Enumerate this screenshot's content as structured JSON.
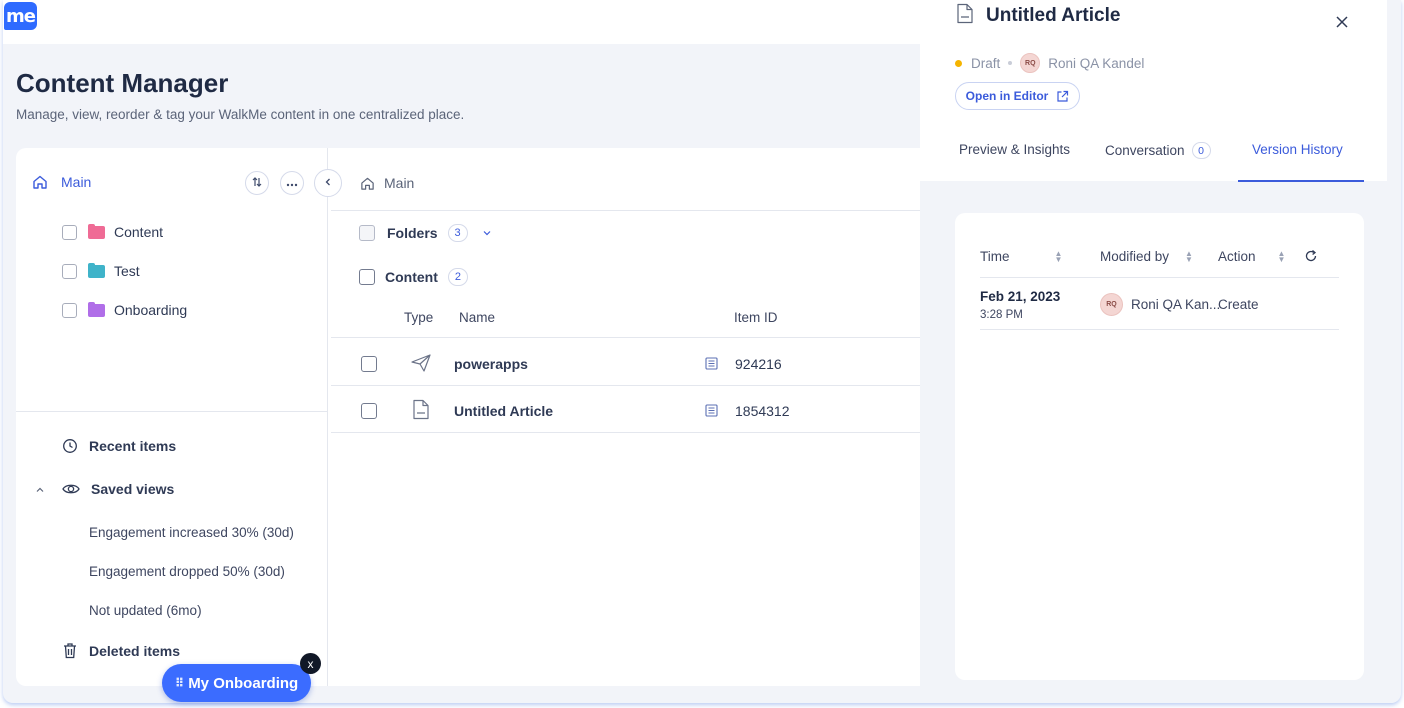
{
  "app": {
    "logo_text": "me",
    "brand_color": "#2f6bff"
  },
  "page": {
    "title": "Content Manager",
    "subtitle": "Manage, view, reorder & tag your WalkMe content in one centralized place."
  },
  "sidebar": {
    "root_label": "Main",
    "folders": [
      {
        "label": "Content",
        "color": "#ef6b95"
      },
      {
        "label": "Test",
        "color": "#3fb3c9"
      },
      {
        "label": "Onboarding",
        "color": "#b06ee8"
      }
    ],
    "recent_label": "Recent items",
    "saved_views_label": "Saved views",
    "saved_views": [
      "Engagement increased 30% (30d)",
      "Engagement dropped 50% (30d)",
      "Not updated (6mo)"
    ],
    "deleted_label": "Deleted items"
  },
  "main": {
    "breadcrumb": "Main",
    "folders_label": "Folders",
    "folders_count": "3",
    "content_label": "Content",
    "content_count": "2",
    "columns": {
      "type": "Type",
      "name": "Name",
      "item_id": "Item ID"
    },
    "rows": [
      {
        "type_icon": "paper-plane-icon",
        "name": "powerapps",
        "item_id": "924216"
      },
      {
        "type_icon": "article-icon",
        "name": "Untitled Article",
        "item_id": "1854312"
      }
    ]
  },
  "panel": {
    "title": "Untitled Article",
    "status": "Draft",
    "status_color": "#f5b400",
    "owner_initials": "RQ",
    "owner": "Roni QA Kandel",
    "open_editor_label": "Open in Editor",
    "tabs": {
      "preview": "Preview & Insights",
      "conversation": "Conversation",
      "conversation_count": "0",
      "history": "Version History"
    },
    "history": {
      "columns": {
        "time": "Time",
        "modified_by": "Modified by",
        "action": "Action"
      },
      "rows": [
        {
          "date": "Feb 21, 2023",
          "time": "3:28 PM",
          "user_initials": "RQ",
          "user": "Roni QA Kan...",
          "action": "Create"
        }
      ]
    }
  },
  "onboarding": {
    "label": "My Onboarding",
    "close": "x"
  }
}
